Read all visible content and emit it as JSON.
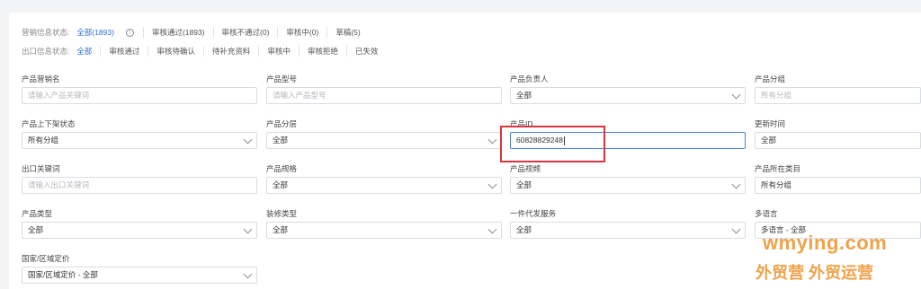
{
  "status": {
    "marketing_label": "营销信息状态:",
    "marketing_options": [
      "全部(1893)",
      "审核通过(1893)",
      "审核不通过(0)",
      "审核中(0)",
      "草稿(5)"
    ],
    "export_label": "出口信息状态:",
    "export_options": [
      "全部",
      "审核通过",
      "审核待确认",
      "待补充资料",
      "审核中",
      "审核拒绝",
      "已失效"
    ]
  },
  "fields": {
    "product_name": {
      "label": "产品营销名",
      "placeholder": "请输入产品关键词"
    },
    "product_model": {
      "label": "产品型号",
      "placeholder": "请输入产品型号"
    },
    "product_owner": {
      "label": "产品负责人",
      "value": "全部"
    },
    "product_group": {
      "label": "产品分组",
      "placeholder": "所有分组"
    },
    "listing_status": {
      "label": "产品上下架状态",
      "value": "所有分组"
    },
    "product_tier": {
      "label": "产品分层",
      "value": "全部"
    },
    "product_id": {
      "label": "产品ID",
      "value": "60828829248"
    },
    "update_time": {
      "label": "更新时间",
      "value": "全部"
    },
    "export_keyword": {
      "label": "出口关键词",
      "placeholder": "请输入出口关键词"
    },
    "product_spec": {
      "label": "产品规格",
      "value": "全部"
    },
    "product_video": {
      "label": "产品视频",
      "value": "全部"
    },
    "product_category": {
      "label": "产品所在类目",
      "value": "所有分组"
    },
    "product_type": {
      "label": "产品类型",
      "value": "全部"
    },
    "decoration_type": {
      "label": "装修类型",
      "value": "全部"
    },
    "dropship_service": {
      "label": "一件代发服务",
      "value": "全部"
    },
    "multi_language": {
      "label": "多语言",
      "value": "多语言 - 全部"
    },
    "country_pricing": {
      "label": "国家/区域定价",
      "value": "国家/区域定价 - 全部"
    }
  },
  "watermark": {
    "line1": "wmying.com",
    "line2": "外贸营 外贸运营"
  },
  "colors": {
    "accent": "#2f6fd6",
    "highlight": "#d9363e",
    "watermark": "#f0a24a"
  }
}
